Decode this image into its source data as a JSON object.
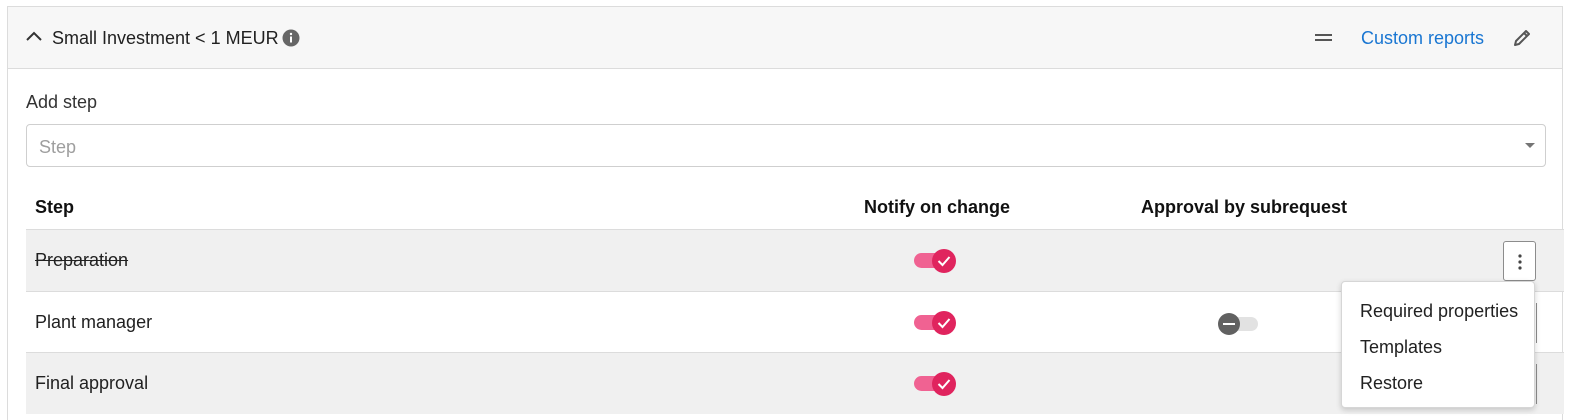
{
  "header": {
    "title": "Small Investment < 1 MEUR",
    "custom_reports_label": "Custom reports",
    "icons": [
      "chevron-up-icon",
      "info-icon",
      "menu-lines-icon",
      "pencil-icon"
    ]
  },
  "add_step": {
    "label": "Add step",
    "placeholder": "Step"
  },
  "table": {
    "columns": [
      "Step",
      "Notify on change",
      "Approval by subrequest"
    ],
    "rows": [
      {
        "label": "Preparation",
        "struck_through": true,
        "notify_on_change": true,
        "approval_by_subrequest": null
      },
      {
        "label": "Plant manager",
        "struck_through": false,
        "notify_on_change": true,
        "approval_by_subrequest": "indeterminate"
      },
      {
        "label": "Final approval",
        "struck_through": false,
        "notify_on_change": true,
        "approval_by_subrequest": null
      }
    ]
  },
  "row_menu": {
    "items": [
      "Required properties",
      "Templates",
      "Restore"
    ]
  },
  "colors": {
    "accent": "#e0245e",
    "accent_track": "#f06292",
    "link": "#1976d2",
    "row_shade": "#f0f0f0"
  }
}
